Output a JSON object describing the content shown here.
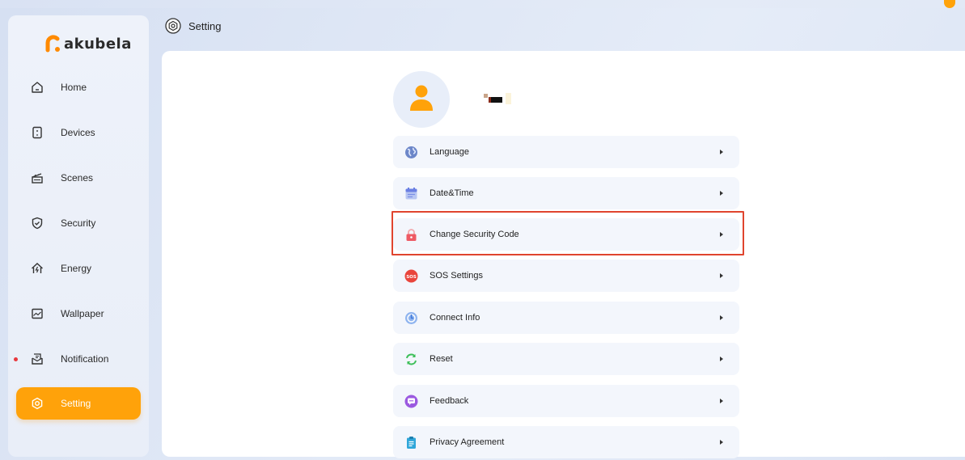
{
  "app": {
    "logo_text": "akubela",
    "brand_color": "#ffa20a"
  },
  "header": {
    "title": "Setting",
    "icon": "setting-gear-icon"
  },
  "sidebar": {
    "items": [
      {
        "label": "Home",
        "icon": "home-icon",
        "active": false
      },
      {
        "label": "Devices",
        "icon": "device-panel-icon",
        "active": false
      },
      {
        "label": "Scenes",
        "icon": "clapperboard-icon",
        "active": false
      },
      {
        "label": "Security",
        "icon": "shield-icon",
        "active": false
      },
      {
        "label": "Energy",
        "icon": "energy-house-icon",
        "active": false
      },
      {
        "label": "Wallpaper",
        "icon": "picture-icon",
        "active": false
      },
      {
        "label": "Notification",
        "icon": "envelope-icon",
        "active": false,
        "has_unread_dot": true
      },
      {
        "label": "Setting",
        "icon": "setting-gear-icon",
        "active": true
      }
    ]
  },
  "profile": {
    "avatar_icon": "user-avatar-icon"
  },
  "settings_menu": [
    {
      "label": "Language",
      "icon": "globe-icon"
    },
    {
      "label": "Date&Time",
      "icon": "calendar-icon"
    },
    {
      "label": "Change Security Code",
      "icon": "lock-icon",
      "highlighted": true
    },
    {
      "label": "SOS Settings",
      "icon": "sos-icon"
    },
    {
      "label": "Connect Info",
      "icon": "connect-icon"
    },
    {
      "label": "Reset",
      "icon": "reset-arrows-icon"
    },
    {
      "label": "Feedback",
      "icon": "feedback-chat-icon"
    },
    {
      "label": "Privacy Agreement",
      "icon": "clipboard-icon"
    }
  ],
  "colors": {
    "highlight_border": "#e0442e",
    "active_nav": "#ffa20a"
  }
}
